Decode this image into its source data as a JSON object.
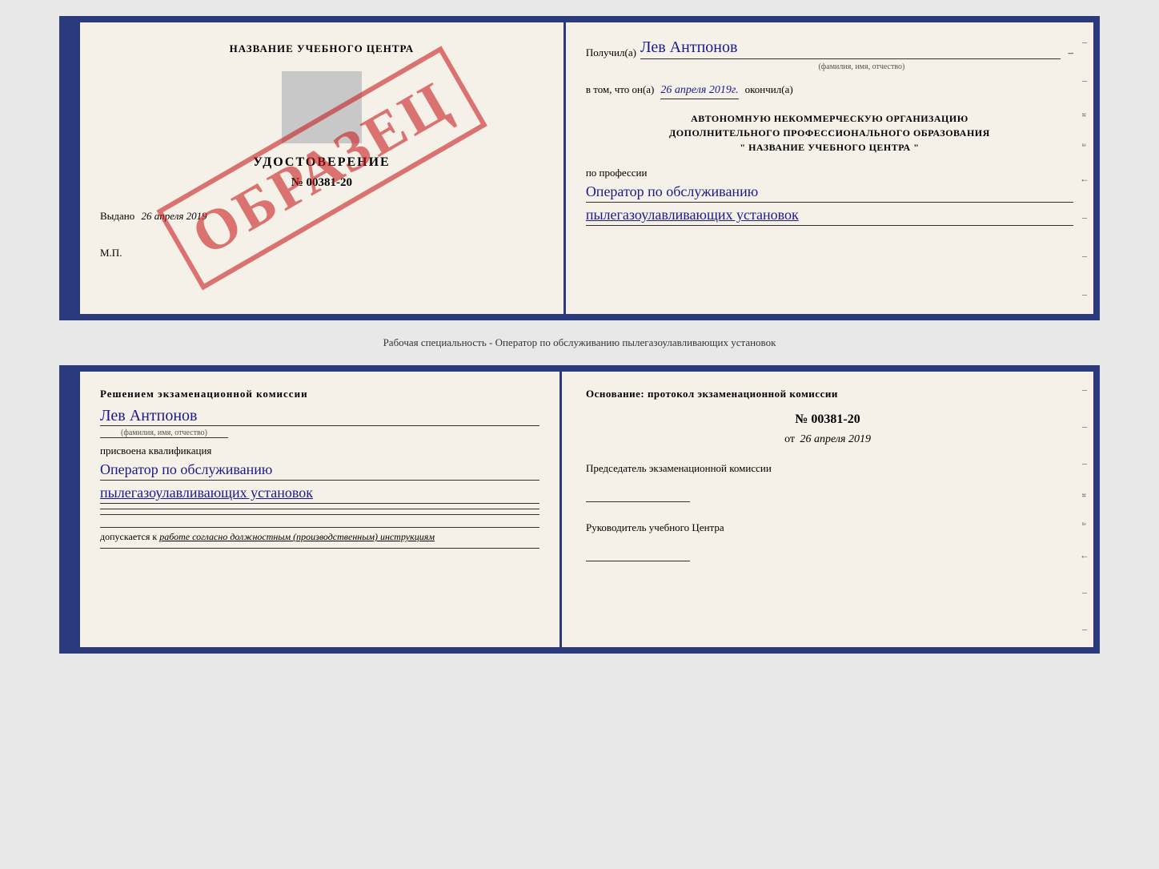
{
  "topCert": {
    "leftPage": {
      "centerNameLabel": "НАЗВАНИЕ УЧЕБНОГО ЦЕНТРА",
      "udostoverenie": "УДОСТОВЕРЕНИЕ",
      "number": "№ 00381-20",
      "vydano": "Выдано",
      "vydanoDate": "26 апреля 2019",
      "mp": "М.П.",
      "obrazets": "ОБРАЗЕЦ"
    },
    "rightPage": {
      "poluchilLabel": "Получил(а)",
      "recipientName": "Лев Антпонов",
      "fioHint": "(фамилия, имя, отчество)",
      "vTomLabel": "в том, что он(а)",
      "completionDate": "26 апреля 2019г.",
      "okonchilLabel": "окончил(а)",
      "orgLine1": "АВТОНОМНУЮ НЕКОММЕРЧЕСКУЮ ОРГАНИЗАЦИЮ",
      "orgLine2": "ДОПОЛНИТЕЛЬНОГО ПРОФЕССИОНАЛЬНОГО ОБРАЗОВАНИЯ",
      "orgLine3": "\"   НАЗВАНИЕ УЧЕБНОГО ЦЕНТРА   \"",
      "poProfessiiLabel": "по профессии",
      "profession1": "Оператор по обслуживанию",
      "profession2": "пылегазоулавливающих установок"
    }
  },
  "middleText": "Рабочая специальность - Оператор по обслуживанию пылегазоулавливающих установок",
  "bottomCert": {
    "leftPage": {
      "resheniyemLabel": "Решением экзаменационной комиссии",
      "personName": "Лев Антпонов",
      "fioHint": "(фамилия, имя, отчество)",
      "prisvoenaLabel": "присвоена квалификация",
      "qualification1": "Оператор по обслуживанию",
      "qualification2": "пылегазоулавливающих установок",
      "dopuskaetsyaLabel": "допускается к",
      "dopuskaetsyaText": "работе согласно должностным (производственным) инструкциям"
    },
    "rightPage": {
      "osnovaniyeLabel": "Основание: протокол экзаменационной комиссии",
      "protocolNumber": "№  00381-20",
      "protocolDatePrefix": "от",
      "protocolDate": "26 апреля 2019",
      "predsedatelLabel": "Председатель экзаменационной комиссии",
      "rukovoditelLabel": "Руководитель учебного Центра"
    }
  }
}
